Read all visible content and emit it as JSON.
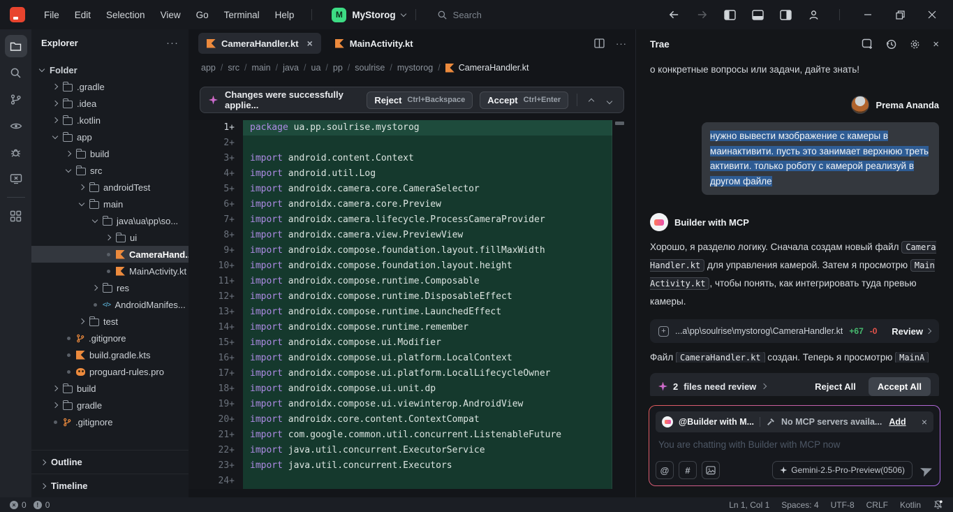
{
  "colors": {
    "logo_red": "#e8442e",
    "accent_green": "#3ddc84",
    "kotlin_orange": "#ec8a3d",
    "keyword_purple": "#ad8be4",
    "diff_add_bg": "#15392d",
    "diff_add_current": "#1e4b3c",
    "selection_blue": "#2e5c94",
    "diff_add_text": "#46b96e",
    "diff_del_text": "#e5534b"
  },
  "titlebar": {
    "menus": [
      "File",
      "Edit",
      "Selection",
      "View",
      "Go",
      "Terminal",
      "Help"
    ],
    "project": {
      "initial": "M",
      "name": "MyStorog"
    },
    "search": {
      "placeholder": "Search"
    }
  },
  "explorer": {
    "title": "Explorer",
    "items": [
      {
        "label": "Folder",
        "level": 0,
        "chev": "down",
        "icon": "",
        "bold": true
      },
      {
        "label": ".gradle",
        "level": 1,
        "chev": "right",
        "icon": "folder"
      },
      {
        "label": ".idea",
        "level": 1,
        "chev": "right",
        "icon": "folder"
      },
      {
        "label": ".kotlin",
        "level": 1,
        "chev": "right",
        "icon": "folder"
      },
      {
        "label": "app",
        "level": 1,
        "chev": "down",
        "icon": "folder"
      },
      {
        "label": "build",
        "level": 2,
        "chev": "right",
        "icon": "folder"
      },
      {
        "label": "src",
        "level": 2,
        "chev": "down",
        "icon": "folder"
      },
      {
        "label": "androidTest",
        "level": 3,
        "chev": "right",
        "icon": "folder"
      },
      {
        "label": "main",
        "level": 3,
        "chev": "down",
        "icon": "folder"
      },
      {
        "label": "java\\ua\\pp\\so...",
        "level": 4,
        "chev": "down",
        "icon": "folder"
      },
      {
        "label": "ui",
        "level": 5,
        "chev": "right",
        "icon": "folder"
      },
      {
        "label": "CameraHand...",
        "level": 5,
        "dot": true,
        "icon": "kotlin",
        "selected": true,
        "bold": true
      },
      {
        "label": "MainActivity.kt",
        "level": 5,
        "dot": true,
        "icon": "kotlin"
      },
      {
        "label": "res",
        "level": 4,
        "chev": "right",
        "icon": "folder"
      },
      {
        "label": "AndroidManifes...",
        "level": 4,
        "dot": true,
        "icon": "xml"
      },
      {
        "label": "test",
        "level": 3,
        "chev": "right",
        "icon": "folder"
      },
      {
        "label": ".gitignore",
        "level": 2,
        "dot": true,
        "icon": "git"
      },
      {
        "label": "build.gradle.kts",
        "level": 2,
        "dot": true,
        "icon": "kotlin"
      },
      {
        "label": "proguard-rules.pro",
        "level": 2,
        "dot": true,
        "icon": "guard"
      },
      {
        "label": "build",
        "level": 1,
        "chev": "right",
        "icon": "folder"
      },
      {
        "label": "gradle",
        "level": 1,
        "chev": "right",
        "icon": "folder"
      },
      {
        "label": ".gitignore",
        "level": 1,
        "dot": true,
        "icon": "git"
      }
    ],
    "sections": {
      "outline": "Outline",
      "timeline": "Timeline"
    }
  },
  "editor": {
    "tabs": [
      {
        "label": "CameraHandler.kt",
        "active": true,
        "closable": true
      },
      {
        "label": "MainActivity.kt",
        "active": false,
        "closable": false
      }
    ],
    "breadcrumb": [
      "app",
      "src",
      "main",
      "java",
      "ua",
      "pp",
      "soulrise",
      "mystorog"
    ],
    "breadcrumb_file": "CameraHandler.kt",
    "notification": {
      "message": "Changes were successfully applie...",
      "reject_label": "Reject",
      "reject_shortcut": "Ctrl+Backspace",
      "accept_label": "Accept",
      "accept_shortcut": "Ctrl+Enter"
    },
    "code_lines": [
      {
        "n": "1+",
        "kw": "package",
        "code": " ua.pp.soulrise.mystorog",
        "current": true
      },
      {
        "n": "2+",
        "kw": "",
        "code": ""
      },
      {
        "n": "3+",
        "kw": "import",
        "code": " android.content.Context"
      },
      {
        "n": "4+",
        "kw": "import",
        "code": " android.util.Log"
      },
      {
        "n": "5+",
        "kw": "import",
        "code": " androidx.camera.core.CameraSelector"
      },
      {
        "n": "6+",
        "kw": "import",
        "code": " androidx.camera.core.Preview"
      },
      {
        "n": "7+",
        "kw": "import",
        "code": " androidx.camera.lifecycle.ProcessCameraProvider"
      },
      {
        "n": "8+",
        "kw": "import",
        "code": " androidx.camera.view.PreviewView"
      },
      {
        "n": "9+",
        "kw": "import",
        "code": " androidx.compose.foundation.layout.fillMaxWidth"
      },
      {
        "n": "10+",
        "kw": "import",
        "code": " androidx.compose.foundation.layout.height"
      },
      {
        "n": "11+",
        "kw": "import",
        "code": " androidx.compose.runtime.Composable"
      },
      {
        "n": "12+",
        "kw": "import",
        "code": " androidx.compose.runtime.DisposableEffect"
      },
      {
        "n": "13+",
        "kw": "import",
        "code": " androidx.compose.runtime.LaunchedEffect"
      },
      {
        "n": "14+",
        "kw": "import",
        "code": " androidx.compose.runtime.remember"
      },
      {
        "n": "15+",
        "kw": "import",
        "code": " androidx.compose.ui.Modifier"
      },
      {
        "n": "16+",
        "kw": "import",
        "code": " androidx.compose.ui.platform.LocalContext"
      },
      {
        "n": "17+",
        "kw": "import",
        "code": " androidx.compose.ui.platform.LocalLifecycleOwner"
      },
      {
        "n": "18+",
        "kw": "import",
        "code": " androidx.compose.ui.unit.dp"
      },
      {
        "n": "19+",
        "kw": "import",
        "code": " androidx.compose.ui.viewinterop.AndroidView"
      },
      {
        "n": "20+",
        "kw": "import",
        "code": " androidx.core.content.ContextCompat"
      },
      {
        "n": "21+",
        "kw": "import",
        "code": " com.google.common.util.concurrent.ListenableFuture"
      },
      {
        "n": "22+",
        "kw": "import",
        "code": " java.util.concurrent.ExecutorService"
      },
      {
        "n": "23+",
        "kw": "import",
        "code": " java.util.concurrent.Executors"
      },
      {
        "n": "24+",
        "kw": "",
        "code": ""
      }
    ]
  },
  "chat": {
    "title": "Trae",
    "scrolled_line": "о конкретные вопросы или задачи, дайте знать!",
    "user": {
      "name": "Prema Ananda",
      "message": "нужно вывести мзображение с камеры в маинактивити. пусть это занимает верхнюю треть активити. только роботу с камерой реализуй в другом файле"
    },
    "assistant": {
      "name": "Builder with MCP",
      "message_parts": [
        {
          "t": "text",
          "s": "Хорошо, я разделю логику. Сначала создам новый файл "
        },
        {
          "t": "code",
          "s": "CameraHandler.kt"
        },
        {
          "t": "text",
          "s": " для управления камерой. Затем я просмотрю "
        },
        {
          "t": "code",
          "s": "MainActivity.kt"
        },
        {
          "t": "text",
          "s": ", чтобы понять, как интегрировать туда превью камеры."
        }
      ],
      "file_card": {
        "path": "...a\\pp\\soulrise\\mystorog\\CameraHandler.kt",
        "additions": "+67",
        "deletions": "-0",
        "review_label": "Review"
      },
      "status_parts": [
        {
          "t": "text",
          "s": "Файл "
        },
        {
          "t": "code",
          "s": "CameraHandler.kt"
        },
        {
          "t": "text",
          "s": " создан. Теперь я просмотрю "
        },
        {
          "t": "code",
          "s": "MainA"
        }
      ]
    },
    "review_bar": {
      "count": "2",
      "label": "files need review",
      "reject_all": "Reject All",
      "accept_all": "Accept All"
    },
    "input": {
      "agent_chip": "@Builder with M...",
      "mcp_status": "No MCP servers availa...",
      "add_label": "Add",
      "placeholder": "You are chatting with Builder with MCP now",
      "model": "Gemini-2.5-Pro-Preview(0506)"
    }
  },
  "statusbar": {
    "errors": "0",
    "warnings": "0",
    "items": [
      "Ln 1, Col 1",
      "Spaces: 4",
      "UTF-8",
      "CRLF",
      "Kotlin"
    ]
  }
}
